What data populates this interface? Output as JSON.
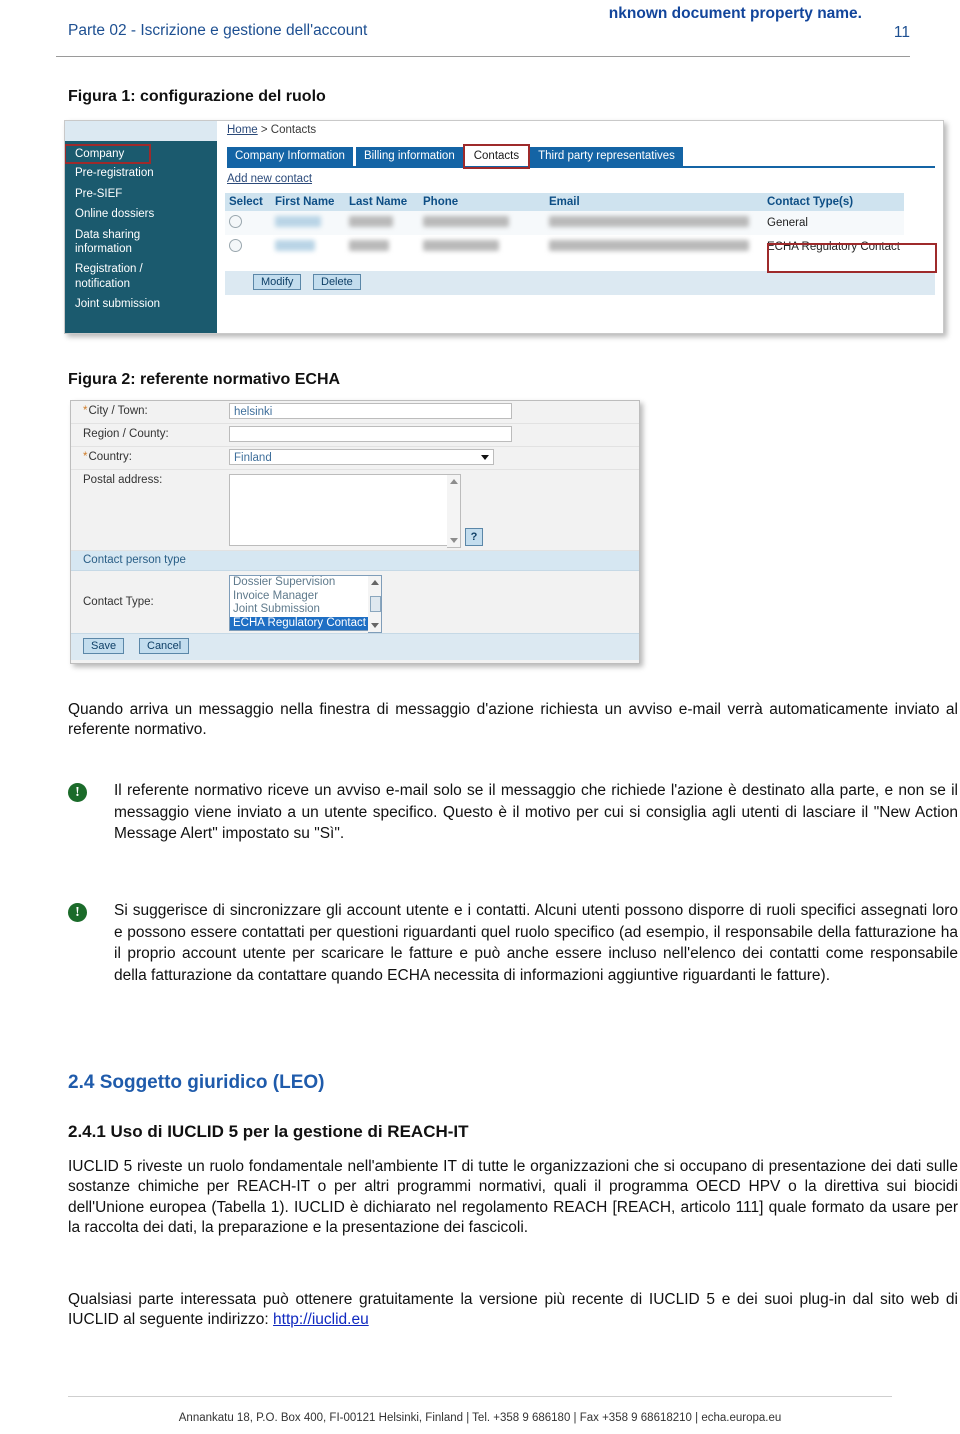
{
  "header": {
    "left_title": "Parte 02 - Iscrizione e gestione dell'account",
    "right_title": "nknown document property name.",
    "page_number": "11"
  },
  "figure1": {
    "caption": "Figura 1: configurazione del ruolo",
    "breadcrumb": {
      "home": "Home",
      "separator": " > ",
      "current": "Contacts"
    },
    "sidebar": [
      "Company",
      "Pre-registration",
      "Pre-SIEF",
      "Online dossiers",
      "Data sharing information",
      "Registration / notification",
      "Joint submission"
    ],
    "tabs": [
      "Company Information",
      "Billing information",
      "Contacts",
      "Third party representatives"
    ],
    "active_tab": "Contacts",
    "add_link": "Add new contact",
    "table": {
      "headers": [
        "Select",
        "First Name",
        "Last Name",
        "Phone",
        "Email",
        "Contact Type(s)"
      ],
      "rows": [
        {
          "contact_type": "General"
        },
        {
          "contact_type": "ECHA Regulatory Contact"
        }
      ]
    },
    "buttons": {
      "modify": "Modify",
      "delete": "Delete"
    }
  },
  "figure2": {
    "caption": "Figura 2: referente normativo ECHA",
    "fields": [
      {
        "label": "City / Town:",
        "required": true,
        "value": "helsinki"
      },
      {
        "label": "Region / County:",
        "required": false,
        "value": ""
      },
      {
        "label": "Country:",
        "required": true,
        "value": "Finland"
      },
      {
        "label": "Postal address:",
        "required": false,
        "value": ""
      }
    ],
    "section_band": "Contact person type",
    "contact_type_label": "Contact Type:",
    "contact_type_options": [
      "Dossier Supervision",
      "Invoice Manager",
      "Joint Submission",
      "ECHA Regulatory Contact"
    ],
    "contact_type_selected": "ECHA Regulatory Contact",
    "help_button": "?",
    "buttons": {
      "save": "Save",
      "cancel": "Cancel"
    }
  },
  "body": {
    "intro_paragraph": "Quando arriva un messaggio nella finestra di messaggio d'azione richiesta un avviso e-mail verrà automaticamente inviato al referente normativo.",
    "note1": "Il referente normativo riceve un avviso e-mail solo se il messaggio che richiede l'azione è destinato alla parte, e non se il messaggio viene inviato a un utente specifico. Questo è il motivo per cui si consiglia agli utenti di lasciare il \"New Action Message Alert\" impostato su \"Sì\".",
    "note2": "Si suggerisce di sincronizzare gli account utente e i contatti. Alcuni utenti possono disporre di ruoli specifici assegnati loro e possono essere contattati per questioni riguardanti quel ruolo specifico (ad esempio, il responsabile della fatturazione ha il proprio account utente per scaricare le fatture e può anche essere incluso nell'elenco dei contatti come responsabile della fatturazione da contattare quando ECHA necessita di informazioni aggiuntive riguardanti le fatture).",
    "heading_2_4": "2.4 Soggetto giuridico (LEO)",
    "heading_2_4_1": "2.4.1 Uso di IUCLID 5 per la gestione di REACH-IT",
    "paragraph_iuclid": "IUCLID 5 riveste un ruolo fondamentale nell'ambiente IT di tutte le organizzazioni che si occupano di presentazione dei dati sulle sostanze chimiche per REACH-IT o per altri programmi normativi, quali il programma OECD HPV o la direttiva sui biocidi dell'Unione europea (Tabella 1). IUCLID è dichiarato nel regolamento REACH [REACH, articolo 111] quale formato da usare per la raccolta dei dati, la preparazione e la presentazione dei fascicoli.",
    "paragraph_plugin_prefix": "Qualsiasi parte interessata può ottenere gratuitamente la versione più recente di IUCLID 5 e dei suoi plug-in dal sito web di IUCLID al seguente indirizzo: ",
    "iuclid_url": "http://iuclid.eu"
  },
  "footer": {
    "text": "Annankatu 18, P.O. Box 400, FI-00121 Helsinki, Finland | Tel. +358 9 686180 | Fax +358 9 68618210 | echa.europa.eu"
  },
  "colors": {
    "header_blue": "#12459b",
    "heading_blue": "#1f5bab",
    "sidebar_teal": "#1b5a6e",
    "tab_blue": "#1464a5",
    "highlight_red": "#9e2a2b",
    "note_green": "#1b6b2a",
    "link_blue": "#0f28c0"
  }
}
